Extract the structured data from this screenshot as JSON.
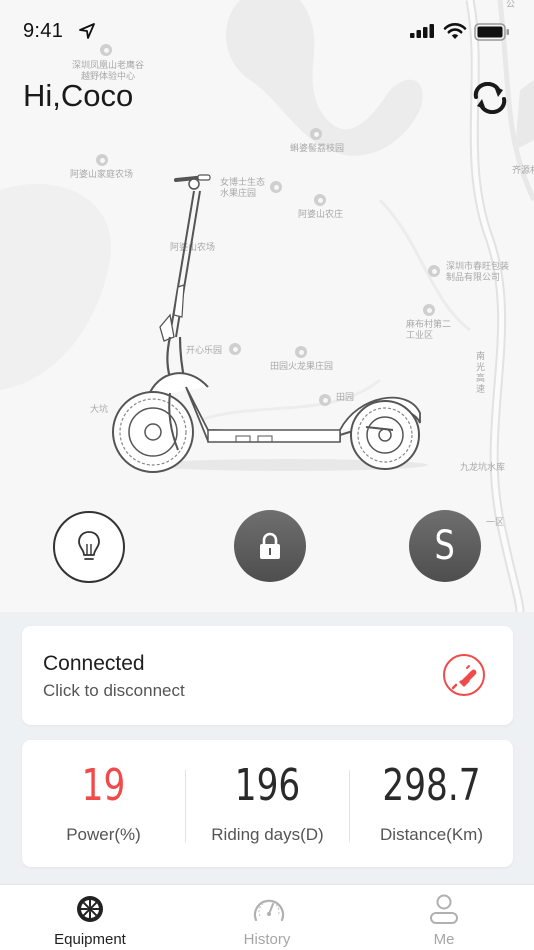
{
  "status_bar": {
    "time": "9:41"
  },
  "header": {
    "greeting": "Hi,Coco"
  },
  "map": {
    "labels": [
      "深圳凤凰山老鹰谷越野体验中心",
      "阿婆山家庭农场",
      "蝌婆髻荔枝园",
      "女博士生态水果庄园",
      "阿婆山农庄",
      "齐源村",
      "深圳市春旺包装制品有限公司",
      "麻布村第二工业区",
      "阿婆山家庭农场",
      "开心乐园",
      "田园火龙果庄园",
      "田园",
      "大坑",
      "九龙坑水库",
      "南光高速",
      "公",
      "一区",
      "阿婆山农场"
    ]
  },
  "controls": {
    "speed_mode": "S"
  },
  "connection": {
    "title": "Connected",
    "subtitle": "Click to disconnect"
  },
  "stats": [
    {
      "value": "19",
      "label": "Power(%)"
    },
    {
      "value": "196",
      "label": "Riding days(D)"
    },
    {
      "value": "298.7",
      "label": "Distance(Km)"
    }
  ],
  "tabs": [
    {
      "label": "Equipment",
      "icon": "wheel-icon"
    },
    {
      "label": "History",
      "icon": "speedometer-icon"
    },
    {
      "label": "Me",
      "icon": "person-icon"
    }
  ],
  "colors": {
    "accent": "#f04a4a",
    "button_dark": "#5e5e5e"
  }
}
